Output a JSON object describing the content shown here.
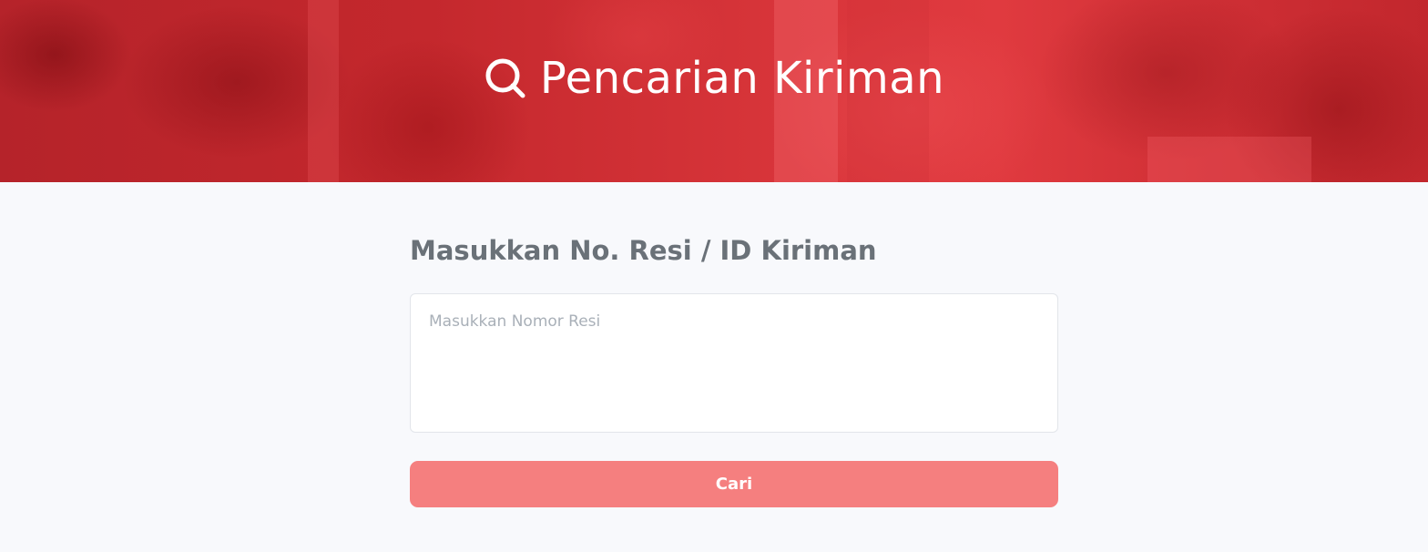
{
  "hero": {
    "title": "Pencarian Kiriman",
    "icon": "search-icon",
    "background_color": "#c8262b"
  },
  "form": {
    "label": "Masukkan No. Resi / ID Kiriman",
    "input_placeholder": "Masukkan Nomor Resi",
    "input_value": "",
    "submit_label": "Cari",
    "button_color": "#f57f7f"
  }
}
